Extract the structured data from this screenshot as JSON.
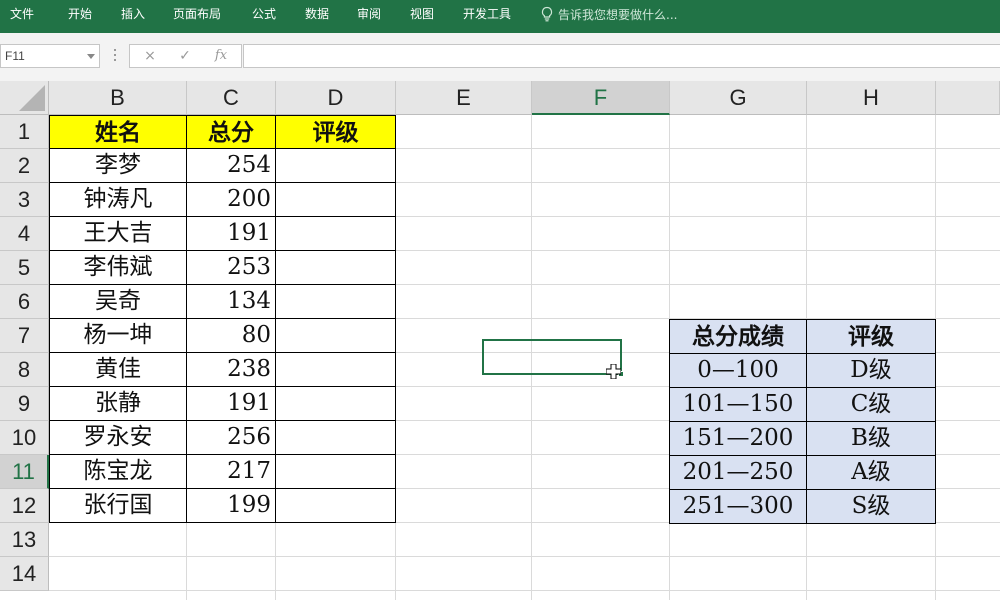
{
  "ribbon": {
    "tabs": [
      "文件",
      "开始",
      "插入",
      "页面布局",
      "公式",
      "数据",
      "审阅",
      "视图",
      "开发工具"
    ],
    "tell_me": "告诉我您想要做什么...",
    "bg_color": "#217346"
  },
  "formula_bar": {
    "name_box": "F11",
    "cancel_icon": "×",
    "enter_icon": "✓",
    "fx_label": "fx",
    "formula": ""
  },
  "columns": [
    "B",
    "C",
    "D",
    "E",
    "F",
    "G",
    "H"
  ],
  "selected_column": "F",
  "rows": [
    "1",
    "2",
    "3",
    "4",
    "5",
    "6",
    "7",
    "8",
    "9",
    "10",
    "11",
    "12",
    "13",
    "14"
  ],
  "selected_row": "11",
  "main_table": {
    "headers": [
      "姓名",
      "总分",
      "评级"
    ],
    "header_color": "#ffff00",
    "rows": [
      {
        "name": "李梦",
        "score": "254",
        "grade": ""
      },
      {
        "name": "钟涛凡",
        "score": "200",
        "grade": ""
      },
      {
        "name": "王大吉",
        "score": "191",
        "grade": ""
      },
      {
        "name": "李伟斌",
        "score": "253",
        "grade": ""
      },
      {
        "name": "吴奇",
        "score": "134",
        "grade": ""
      },
      {
        "name": "杨一坤",
        "score": "80",
        "grade": ""
      },
      {
        "name": "黄佳",
        "score": "238",
        "grade": ""
      },
      {
        "name": "张静",
        "score": "191",
        "grade": ""
      },
      {
        "name": "罗永安",
        "score": "256",
        "grade": ""
      },
      {
        "name": "陈宝龙",
        "score": "217",
        "grade": ""
      },
      {
        "name": "张行国",
        "score": "199",
        "grade": ""
      }
    ]
  },
  "lookup_table": {
    "headers": [
      "总分成绩",
      "评级"
    ],
    "fill_color": "#d9e1f2",
    "rows": [
      {
        "range": "0—100",
        "grade": "D级"
      },
      {
        "range": "101—150",
        "grade": "C级"
      },
      {
        "range": "151—200",
        "grade": "B级"
      },
      {
        "range": "201—250",
        "grade": "A级"
      },
      {
        "range": "251—300",
        "grade": "S级"
      }
    ]
  },
  "active_cell": "F11",
  "accent_color": "#217346"
}
